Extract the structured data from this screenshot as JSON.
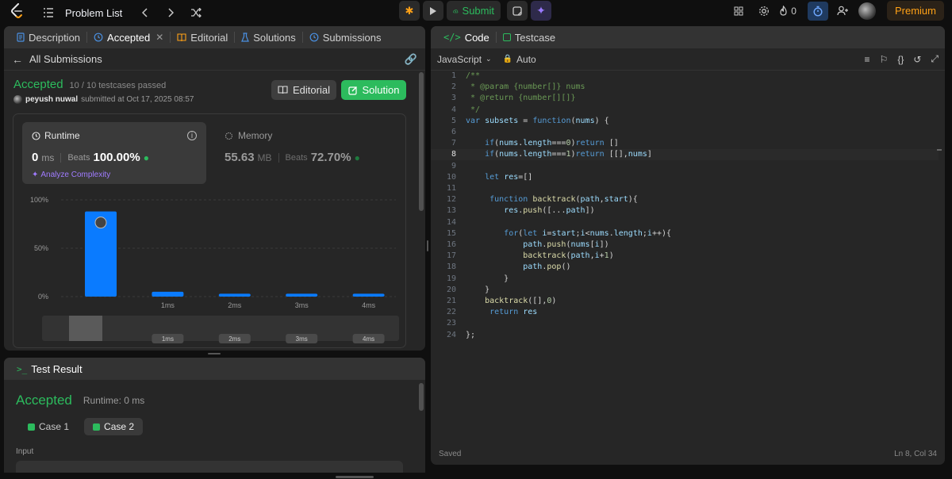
{
  "topbar": {
    "problem_list_label": "Problem List",
    "submit_label": "Submit",
    "streak_count": "0",
    "premium_label": "Premium"
  },
  "left_tabs": [
    {
      "label": "Description",
      "icon": "file-icon"
    },
    {
      "label": "Accepted",
      "icon": "history-icon"
    },
    {
      "label": "Editorial",
      "icon": "book-icon"
    },
    {
      "label": "Solutions",
      "icon": "flask-icon"
    },
    {
      "label": "Submissions",
      "icon": "history-icon"
    }
  ],
  "submission": {
    "back_label": "All Submissions",
    "status": "Accepted",
    "testcases": "10 / 10 testcases passed",
    "user": "peyush nuwal",
    "submitted_text": "submitted at Oct 17, 2025 08:57",
    "editorial_btn": "Editorial",
    "solution_btn": "Solution",
    "runtime_title": "Runtime",
    "runtime_value": "0",
    "runtime_unit": "ms",
    "beats_label": "Beats",
    "runtime_beats": "100.00%",
    "analyze_label": "Analyze Complexity",
    "memory_title": "Memory",
    "memory_value": "55.63",
    "memory_unit": "MB",
    "memory_beats": "72.70%"
  },
  "chart_data": {
    "type": "bar",
    "categories": [
      "",
      "1ms",
      "2ms",
      "3ms",
      "4ms"
    ],
    "values": [
      88,
      5,
      3,
      3,
      3
    ],
    "y_ticks": [
      "100%",
      "50%",
      "0%"
    ],
    "ylim": [
      0,
      100
    ],
    "bar_color": "#0a7bff",
    "highlight_index": 0
  },
  "test_result": {
    "tab_label": "Test Result",
    "status": "Accepted",
    "runtime_text": "Runtime: 0 ms",
    "cases": [
      "Case 1",
      "Case 2"
    ],
    "selected_case": 1,
    "input_label": "Input"
  },
  "code_panel": {
    "tab_code": "Code",
    "tab_testcase": "Testcase",
    "language": "JavaScript",
    "auto_label": "Auto",
    "saved_label": "Saved",
    "cursor_pos": "Ln 8, Col 34",
    "active_line": 8,
    "lines": [
      "/**",
      " * @param {number[]} nums",
      " * @return {number[][]}",
      " */",
      "var subsets = function(nums) {",
      "",
      "    if(nums.length===0)return []",
      "    if(nums.length===1)return [[],nums]",
      "",
      "    let res=[]",
      "",
      "     function backtrack(path,start){",
      "        res.push([...path])",
      "",
      "        for(let i=start;i<nums.length;i++){",
      "            path.push(nums[i])",
      "            backtrack(path,i+1)",
      "            path.pop()",
      "        }",
      "    }",
      "    backtrack([],0)",
      "     return res",
      "",
      "};"
    ]
  },
  "colors": {
    "accent_green": "#2cbb5d",
    "premium_orange": "#ffa116",
    "bar_blue": "#0a7bff"
  }
}
